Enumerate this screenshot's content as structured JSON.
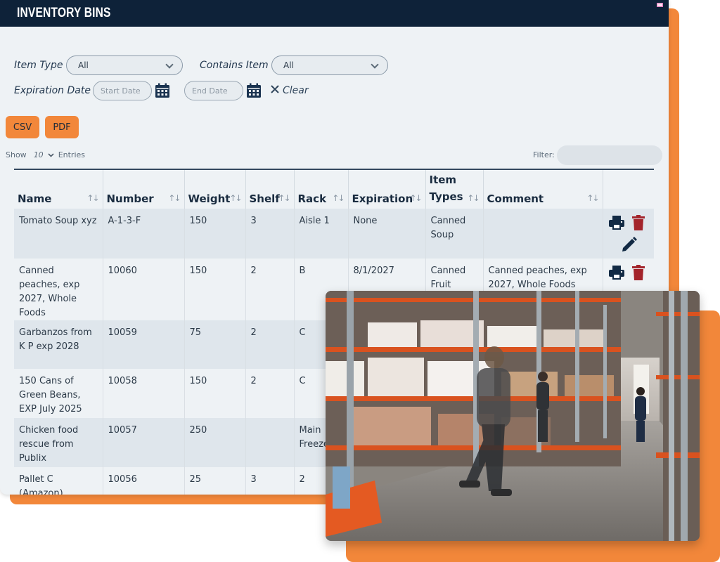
{
  "window": {
    "title": "INVENTORY BINS"
  },
  "filters": {
    "item_type_label": "Item Type",
    "item_type_value": "All",
    "contains_item_label": "Contains Item",
    "contains_item_value": "All",
    "expiration_label": "Expiration Date",
    "start_placeholder": "Start Date",
    "end_placeholder": "End Date",
    "clear_label": "Clear"
  },
  "export": {
    "csv_label": "CSV",
    "pdf_label": "PDF"
  },
  "entries": {
    "show_label": "Show",
    "count": "10",
    "entries_label": "Entries",
    "filter_label": "Filter:"
  },
  "table": {
    "headers": [
      "Name",
      "Number",
      "Weight",
      "Shelf",
      "Rack",
      "Expiration",
      "Item Types",
      "Comment"
    ],
    "rows": [
      {
        "name": "Tomato Soup xyz",
        "number": "A-1-3-F",
        "weight": "150",
        "shelf": "3",
        "rack": "Aisle 1",
        "expiration": "None",
        "types": "Canned Soup",
        "comment": ""
      },
      {
        "name": "Canned peaches, exp 2027, Whole Foods",
        "number": "10060",
        "weight": "150",
        "shelf": "2",
        "rack": "B",
        "expiration": "8/1/2027",
        "types": "Canned Fruit",
        "comment": "Canned peaches, exp 2027, Whole Foods"
      },
      {
        "name": "Garbanzos from K P exp 2028",
        "number": "10059",
        "weight": "75",
        "shelf": "2",
        "rack": "C",
        "expiration": "",
        "types": "",
        "comment": ""
      },
      {
        "name": "150 Cans of Green Beans, EXP July 2025",
        "number": "10058",
        "weight": "150",
        "shelf": "2",
        "rack": "C",
        "expiration": "",
        "types": "",
        "comment": ""
      },
      {
        "name": "Chicken food rescue from Publix",
        "number": "10057",
        "weight": "250",
        "shelf": "",
        "rack": "Main Freeze",
        "expiration": "",
        "types": "",
        "comment": ""
      },
      {
        "name": "Pallet C (Amazon)",
        "number": "10056",
        "weight": "25",
        "shelf": "3",
        "rack": "2",
        "expiration": "",
        "types": "",
        "comment": ""
      }
    ]
  },
  "icons": {
    "print": "print-icon",
    "delete": "trash-icon",
    "edit": "pencil-icon",
    "calendar": "calendar-icon",
    "clear": "close-icon"
  },
  "colors": {
    "brand_navy": "#0e2239",
    "accent_orange": "#f2873a",
    "delete_red": "#a3242b"
  }
}
